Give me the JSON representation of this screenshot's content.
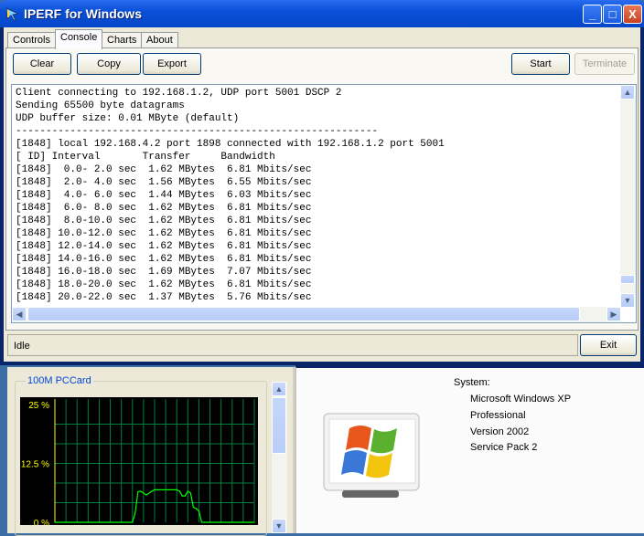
{
  "window": {
    "title": "IPERF for Windows",
    "controls": {
      "minimize": "_",
      "maximize": "□",
      "close": "X"
    }
  },
  "tabs": [
    {
      "label": "Controls"
    },
    {
      "label": "Console",
      "active": true
    },
    {
      "label": "Charts"
    },
    {
      "label": "About"
    }
  ],
  "toolbar": {
    "clear": "Clear",
    "copy": "Copy",
    "export": "Export",
    "start": "Start",
    "terminate": "Terminate"
  },
  "console": {
    "lines": [
      "Client connecting to 192.168.1.2, UDP port 5001 DSCP 2",
      "Sending 65500 byte datagrams",
      "UDP buffer size: 0.01 MByte (default)",
      "------------------------------------------------------------",
      "[1848] local 192.168.4.2 port 1898 connected with 192.168.1.2 port 5001",
      "[ ID] Interval       Transfer     Bandwidth",
      "[1848]  0.0- 2.0 sec  1.62 MBytes  6.81 Mbits/sec",
      "[1848]  2.0- 4.0 sec  1.56 MBytes  6.55 Mbits/sec",
      "[1848]  4.0- 6.0 sec  1.44 MBytes  6.03 Mbits/sec",
      "[1848]  6.0- 8.0 sec  1.62 MBytes  6.81 Mbits/sec",
      "[1848]  8.0-10.0 sec  1.62 MBytes  6.81 Mbits/sec",
      "[1848] 10.0-12.0 sec  1.62 MBytes  6.81 Mbits/sec",
      "[1848] 12.0-14.0 sec  1.62 MBytes  6.81 Mbits/sec",
      "[1848] 14.0-16.0 sec  1.62 MBytes  6.81 Mbits/sec",
      "[1848] 16.0-18.0 sec  1.69 MBytes  7.07 Mbits/sec",
      "[1848] 18.0-20.0 sec  1.62 MBytes  6.81 Mbits/sec",
      "[1848] 20.0-22.0 sec  1.37 MBytes  5.76 Mbits/sec"
    ]
  },
  "status": {
    "text": "Idle",
    "exit": "Exit"
  },
  "network_monitor": {
    "label": "100M PCCard"
  },
  "chart_data": {
    "type": "line",
    "title": "100M PCCard",
    "ylabel": "",
    "xlabel": "",
    "ylim": [
      0,
      25
    ],
    "yticks": [
      "25 %",
      "12.5 %",
      "0 %"
    ],
    "grid": true,
    "x": [
      0,
      28,
      29,
      30,
      31,
      33,
      35,
      36,
      44,
      45,
      46,
      47,
      48,
      49,
      50,
      51,
      52,
      53,
      54,
      72
    ],
    "values": [
      0,
      0,
      2,
      6.5,
      6.6,
      5.8,
      6.6,
      6.9,
      6.9,
      6.6,
      5.6,
      5.6,
      6.6,
      6.2,
      3.2,
      2.9,
      2.4,
      0,
      0,
      0
    ]
  },
  "system": {
    "heading": "System:",
    "lines": [
      "Microsoft Windows XP",
      "Professional",
      "Version 2002",
      "Service Pack 2"
    ]
  },
  "colors": {
    "titlebar": "#0a50d8",
    "plot_bg": "#000000",
    "grid": "#008040",
    "trace": "#00ff00",
    "ticks": "#ffff00"
  }
}
